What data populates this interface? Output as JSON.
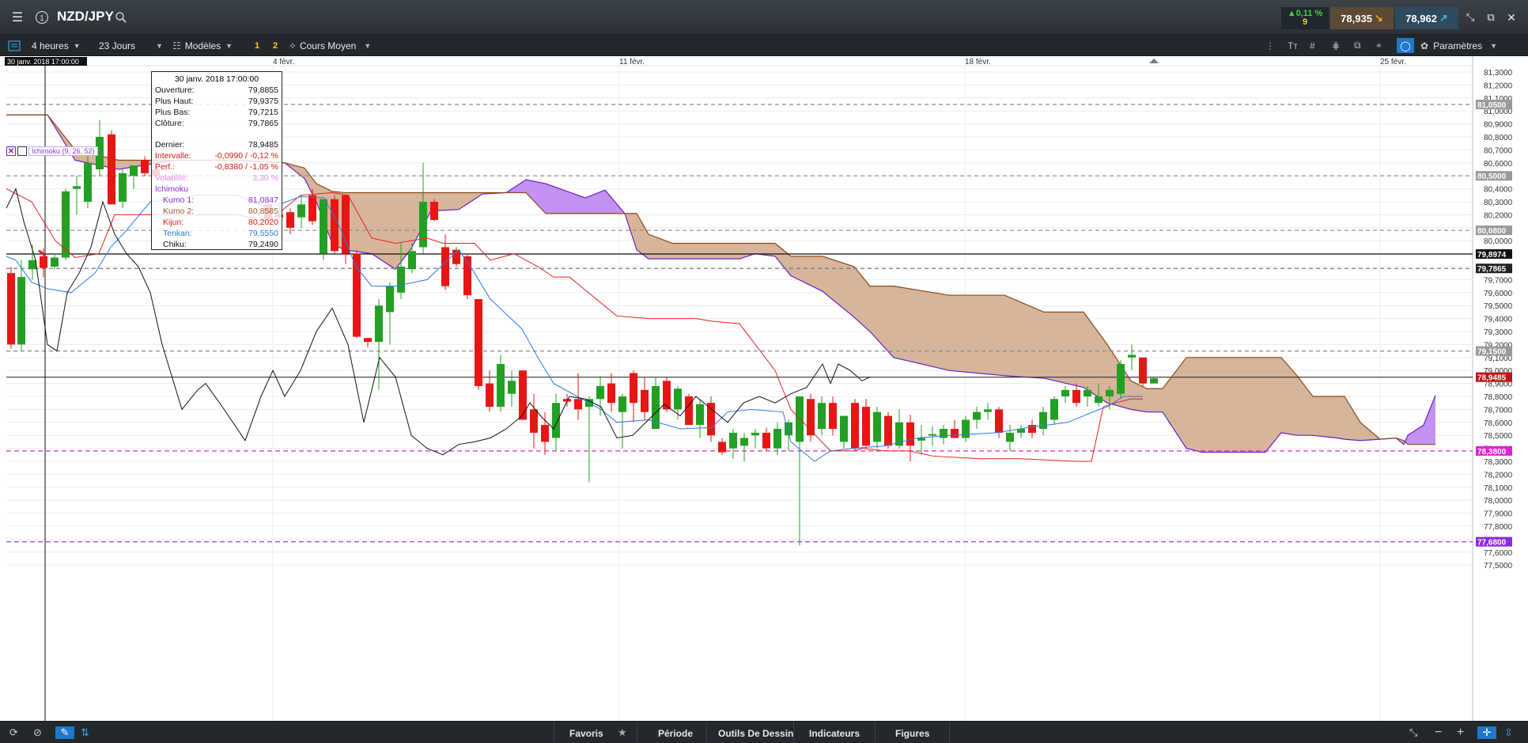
{
  "header": {
    "menu_icon": "hamburger-icon",
    "info_icon": "info-circle-icon",
    "symbol": "NZD/JPY",
    "search_icon": "search-icon",
    "change_pct": "▲0,11 %",
    "change_count": "9",
    "bid": "78,935",
    "ask": "78,962",
    "window_icons": [
      "collapse-icon",
      "popout-icon",
      "close-icon"
    ]
  },
  "toolbar": {
    "timeframe": "4 heures",
    "period": "23 Jours",
    "models": "Modèles",
    "layout_1": "1",
    "layout_2": "2",
    "price_type": "Cours Moyen",
    "parameters": "Paramètres"
  },
  "chart": {
    "crosshair_time": "30 janv. 2018 17:00:00",
    "date_labels": [
      "4 févr.",
      "11 févr.",
      "18 févr.",
      "25 févr."
    ],
    "price_ticks": [
      "81,3000",
      "81,2000",
      "81,1000",
      "81,0000",
      "80,9000",
      "80,8000",
      "80,7000",
      "80,6000",
      "80,5000",
      "80,4000",
      "80,3000",
      "80,2000",
      "80,1000",
      "80,0000",
      "79,9000",
      "79,8000",
      "79,7000",
      "79,6000",
      "79,5000",
      "79,4000",
      "79,3000",
      "79,2000",
      "79,1000",
      "79,0000",
      "78,9000",
      "78,8000",
      "78,7000",
      "78,6000",
      "78,5000",
      "78,4000",
      "78,3000",
      "78,2000",
      "78,1000",
      "78,0000",
      "77,9000",
      "77,8000",
      "77,7000",
      "77,6000",
      "77,5000"
    ],
    "level_badges": [
      {
        "label": "81,0500",
        "color": "#9a9a9a"
      },
      {
        "label": "80,5000",
        "color": "#9a9a9a"
      },
      {
        "label": "80,0800",
        "color": "#9a9a9a"
      },
      {
        "label": "79,8974",
        "color": "#111111"
      },
      {
        "label": "79,7865",
        "color": "#222222"
      },
      {
        "label": "79,1500",
        "color": "#9a9a9a"
      },
      {
        "label": "78,9485",
        "color": "#c0121a"
      },
      {
        "label": "78,3800",
        "color": "#e020d0"
      },
      {
        "label": "77,6800",
        "color": "#8a2be2"
      }
    ],
    "indicator_chip": "Ichimoku (9, 26, 52)"
  },
  "info_panel": {
    "datetime": "30 janv. 2018 17:00:00",
    "rows": [
      {
        "label": "Ouverture:",
        "value": "79,8855",
        "color": "#111111"
      },
      {
        "label": "Plus Haut:",
        "value": "79,9375",
        "color": "#111111"
      },
      {
        "label": "Plus Bas:",
        "value": "79,7215",
        "color": "#111111"
      },
      {
        "label": "Clôture:",
        "value": "79,7865",
        "color": "#111111"
      }
    ],
    "rows2": [
      {
        "label": "Dernier:",
        "value": "78,9485",
        "color": "#111111"
      },
      {
        "label": "Intervalle:",
        "value": "-0,0990 / -0,12 %",
        "color": "#d21a1a"
      },
      {
        "label": "Perf.:",
        "value": "-0,8380 / -1,05 %",
        "color": "#d21a1a"
      },
      {
        "label": "Volatilité:",
        "value": "3,30 %",
        "color": "#e58be0"
      }
    ],
    "ichimoku_title": "Ichimoku",
    "ichimoku": [
      {
        "label": "Kumo 1:",
        "value": "81,0847",
        "color": "#8a2be2"
      },
      {
        "label": "Kumo 2:",
        "value": "80,8585",
        "color": "#9a5a2e"
      },
      {
        "label": "Kijun:",
        "value": "80,2020",
        "color": "#e01b1b"
      },
      {
        "label": "Tenkan:",
        "value": "79,5550",
        "color": "#2a78d8"
      },
      {
        "label": "Chiku:",
        "value": "79,2490",
        "color": "#111111"
      }
    ]
  },
  "bottombar": {
    "favorites": "Favoris",
    "period": "Période",
    "drawing_tools": "Outils De Dessin",
    "indicators": "Indicateurs",
    "figures": "Figures"
  },
  "colors": {
    "bull": "#23a023",
    "bear": "#e81515",
    "kumo_bear": "#cfa88a",
    "kumo_bull": "#b97ff0",
    "kijun": "#e82020",
    "tenkan": "#2c7be5",
    "chikou": "#111111"
  }
}
